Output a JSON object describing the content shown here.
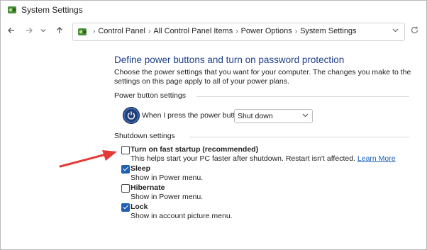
{
  "window": {
    "title": "System Settings",
    "icon": "control-panel-icon"
  },
  "nav": {
    "back_icon": "arrow-left-icon",
    "forward_icon": "arrow-right-icon",
    "recent_icon": "chevron-down-icon",
    "up_icon": "arrow-up-icon",
    "breadcrumb": [
      "Control Panel",
      "All Control Panel Items",
      "Power Options",
      "System Settings"
    ],
    "refresh_icon": "refresh-icon"
  },
  "page": {
    "heading": "Define power buttons and turn on password protection",
    "description": "Choose the power settings that you want for your computer. The changes you make to the settings on this page apply to all of your power plans.",
    "power_section_label": "Power button settings",
    "power_button_label": "When I press the power button:",
    "power_button_value": "Shut down",
    "shutdown_section_label": "Shutdown settings",
    "options": [
      {
        "title": "Turn on fast startup (recommended)",
        "desc": "This helps start your PC faster after shutdown. Restart isn't affected.",
        "link": "Learn More",
        "checked": false
      },
      {
        "title": "Sleep",
        "desc": "Show in Power menu.",
        "checked": true
      },
      {
        "title": "Hibernate",
        "desc": "Show in Power menu.",
        "checked": false
      },
      {
        "title": "Lock",
        "desc": "Show in account picture menu.",
        "checked": true
      }
    ]
  },
  "colors": {
    "heading": "#1e3f8a",
    "accent": "#1e5fb4",
    "annotation_arrow": "#e53935"
  }
}
